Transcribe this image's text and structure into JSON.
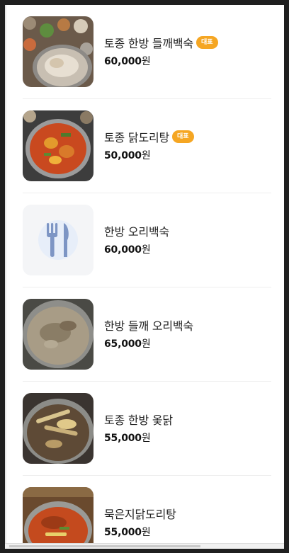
{
  "menu": {
    "badge_label": "대표",
    "currency": "원",
    "items": [
      {
        "name": "토종 한방 들깨백숙",
        "price": "60,000",
        "badge": true,
        "image": "food-photo"
      },
      {
        "name": "토종 닭도리탕",
        "price": "50,000",
        "badge": true,
        "image": "food-photo"
      },
      {
        "name": "한방 오리백숙",
        "price": "60,000",
        "badge": false,
        "image": "placeholder"
      },
      {
        "name": "한방 들깨 오리백숙",
        "price": "65,000",
        "badge": false,
        "image": "food-photo"
      },
      {
        "name": "토종 한방 옻닭",
        "price": "55,000",
        "badge": false,
        "image": "food-photo"
      },
      {
        "name": "묵은지닭도리탕",
        "price": "55,000",
        "badge": false,
        "image": "food-photo"
      }
    ]
  },
  "icons": {
    "placeholder": "fork-knife-icon"
  },
  "colors": {
    "badge": "#f5a623",
    "placeholder_bg": "#f4f5f7",
    "placeholder_icon": "#7d95c4"
  }
}
